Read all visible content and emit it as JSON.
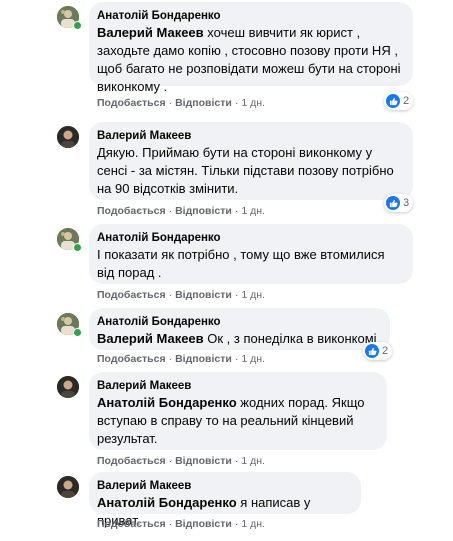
{
  "actions": {
    "like_label": "Подобається",
    "reply_label": "Відповісти",
    "separator": "·"
  },
  "comments": [
    {
      "author": "Анатолій Бондаренко",
      "mention": "Валерий Макеев",
      "text": " хочеш вивчити як юрист , заходьте дамо копію , стосовно позову проти НЯ , щоб багато не розповідати можеш бути на стороні виконкому .",
      "time": "1 дн.",
      "reactions": "2",
      "avatar_icon": "profile-photo-icon",
      "online": true
    },
    {
      "author": "Валерий Макеев",
      "mention": "",
      "text": "Дякую. Приймаю бути на стороні виконкому у сенсі - за містян. Тільки підстави позову потрібно на 90 відсотків змінити.",
      "time": "1 дн.",
      "reactions": "3",
      "avatar_icon": "profile-photo-icon",
      "online": false
    },
    {
      "author": "Анатолій Бондаренко",
      "mention": "",
      "text": "І показати як потрібно , тому що вже втомилися від порад .",
      "time": "1 дн.",
      "reactions": "",
      "avatar_icon": "profile-photo-icon",
      "online": true
    },
    {
      "author": "Анатолій Бондаренко",
      "mention": "Валерий Макеев",
      "text": " Ок , з понеділка в виконкомі .",
      "time": "1 дн.",
      "reactions": "2",
      "avatar_icon": "profile-photo-icon",
      "online": true
    },
    {
      "author": "Валерий Макеев",
      "mention": "Анатолій Бондаренко",
      "text": " жодних порад. Якщо вступаю в справу то на реальний кінцевий результат.",
      "time": "1 дн.",
      "reactions": "",
      "avatar_icon": "profile-photo-icon",
      "online": false
    },
    {
      "author": "Валерий Макеев",
      "mention": "Анатолій Бондаренко",
      "text": " я написав у приват",
      "time": "1 дн.",
      "reactions": "",
      "avatar_icon": "profile-photo-icon",
      "online": false
    }
  ],
  "colors": {
    "bubble": "#f0f2f5",
    "meta_text": "#65676b",
    "like_blue": "#1877f2",
    "online_green": "#31a24c"
  }
}
